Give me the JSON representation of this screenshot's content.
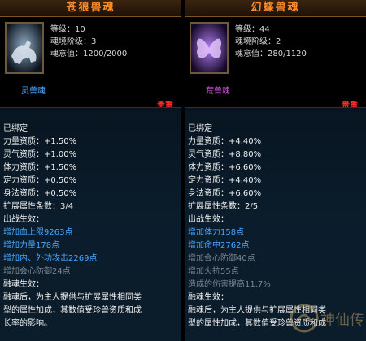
{
  "left": {
    "title": "苍狼兽魂",
    "stats": [
      "等级：10",
      "魂境阶级：3",
      "魂意值：1200/2000"
    ],
    "soul_type": "灵兽魂",
    "grade": "贵重",
    "soul_type_color": "#4aa8ff",
    "lines": [
      "已绑定",
      "力量资质：+1.50%",
      "灵气资质：+1.00%",
      "体力资质：+1.50%",
      "定力资质：+0.50%",
      "身法资质：+0.50%",
      "扩展属性条数：3/4",
      "出战生效：",
      "增加血上限9263点",
      "增加力量178点",
      "增加内、外功攻击2269点",
      "增加会心防御24点",
      "融魂生效：",
      "融魂后，为主人提供与扩展属性相同类",
      "型的属性加成，其数值受珍兽资质和成",
      "长率的影响。"
    ]
  },
  "right": {
    "title": "幻蝶兽魂",
    "stats": [
      "等级：44",
      "魂境阶级：2",
      "魂意值：280/1120"
    ],
    "soul_type": "荒兽魂",
    "grade": "贵重",
    "soul_type_color": "#d04bd8",
    "lines": [
      "已绑定",
      "力量资质：+4.40%",
      "灵气资质：+8.80%",
      "体力资质：+6.60%",
      "定力资质：+4.40%",
      "身法资质：+6.60%",
      "扩展属性条数：2/5",
      "出战生效：",
      "增加体力158点",
      "增加命中2762点",
      "增加会心防御40点",
      "增加火抗55点",
      "造成的伤害提高11.7%",
      "融魂生效：",
      "融魂后，为主人提供与扩展属性相同类",
      "型的属性加成，其数值受珍兽资质和成"
    ]
  },
  "watermark": "神仙传"
}
